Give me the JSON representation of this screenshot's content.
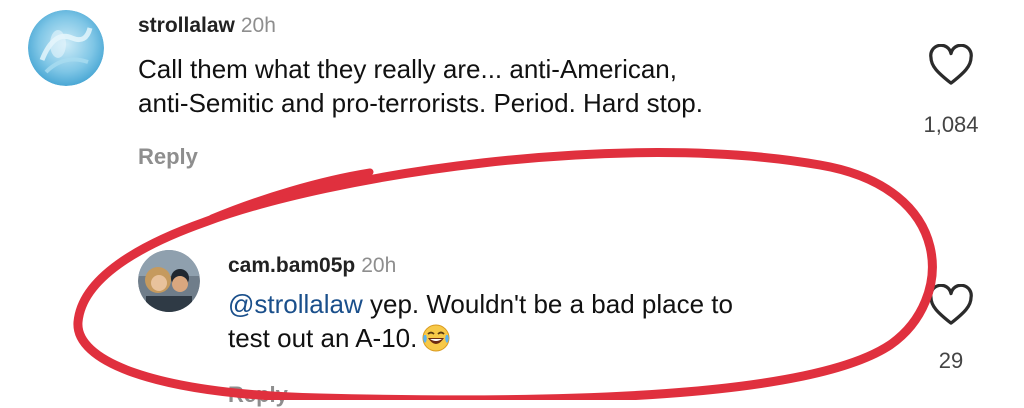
{
  "comments": [
    {
      "username": "strollalaw",
      "time": "20h",
      "text_lines": [
        "Call them what they really are... anti-American,",
        "anti-Semitic and pro-terrorists. Period. Hard stop."
      ],
      "reply_label": "Reply",
      "like_count": "1,084"
    },
    {
      "username": "cam.bam05p",
      "time": "20h",
      "mention": "@strollalaw",
      "text_line1_rest": " yep. Wouldn't be a bad place to",
      "text_line2": "test out an A-10.",
      "emoji": "laughing-with-tears",
      "reply_label": "Reply",
      "like_count": "29"
    }
  ],
  "colors": {
    "annotation_circle": "#e0303e",
    "mention": "#1a4f8b",
    "secondary_text": "#8e8e8e"
  }
}
